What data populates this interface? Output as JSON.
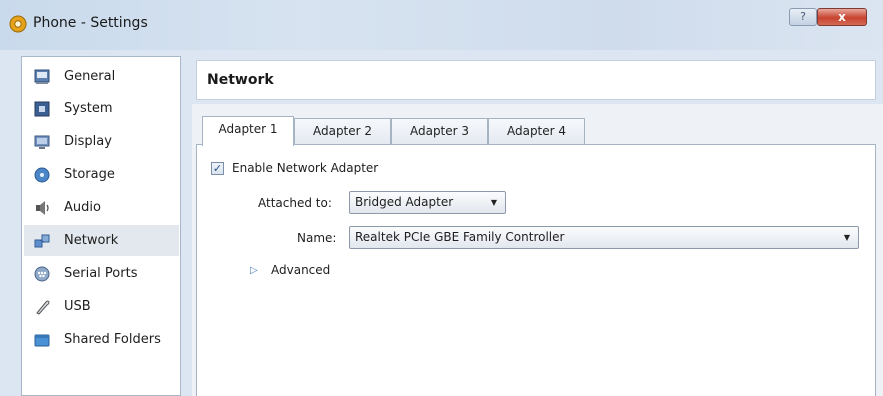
{
  "window": {
    "title": "Phone - Settings",
    "help_glyph": "?",
    "close_glyph": "x"
  },
  "sidebar": {
    "items": [
      {
        "label": "General",
        "icon": "general-icon"
      },
      {
        "label": "System",
        "icon": "system-icon"
      },
      {
        "label": "Display",
        "icon": "display-icon"
      },
      {
        "label": "Storage",
        "icon": "storage-icon"
      },
      {
        "label": "Audio",
        "icon": "audio-icon"
      },
      {
        "label": "Network",
        "icon": "network-icon",
        "selected": true
      },
      {
        "label": "Serial Ports",
        "icon": "serial-ports-icon"
      },
      {
        "label": "USB",
        "icon": "usb-icon"
      },
      {
        "label": "Shared Folders",
        "icon": "shared-folders-icon"
      }
    ]
  },
  "page": {
    "title": "Network"
  },
  "tabs": [
    {
      "label": "Adapter 1",
      "active": true
    },
    {
      "label": "Adapter 2"
    },
    {
      "label": "Adapter 3"
    },
    {
      "label": "Adapter 4"
    }
  ],
  "adapter": {
    "enable_label": "Enable Network Adapter",
    "enabled": true,
    "check_glyph": "✓",
    "attached_label": "Attached to:",
    "attached_value": "Bridged Adapter",
    "name_label": "Name:",
    "name_value": "Realtek PCIe GBE Family Controller",
    "dropdown_glyph": "▼",
    "advanced_label": "Advanced",
    "advanced_glyph": "▷"
  }
}
